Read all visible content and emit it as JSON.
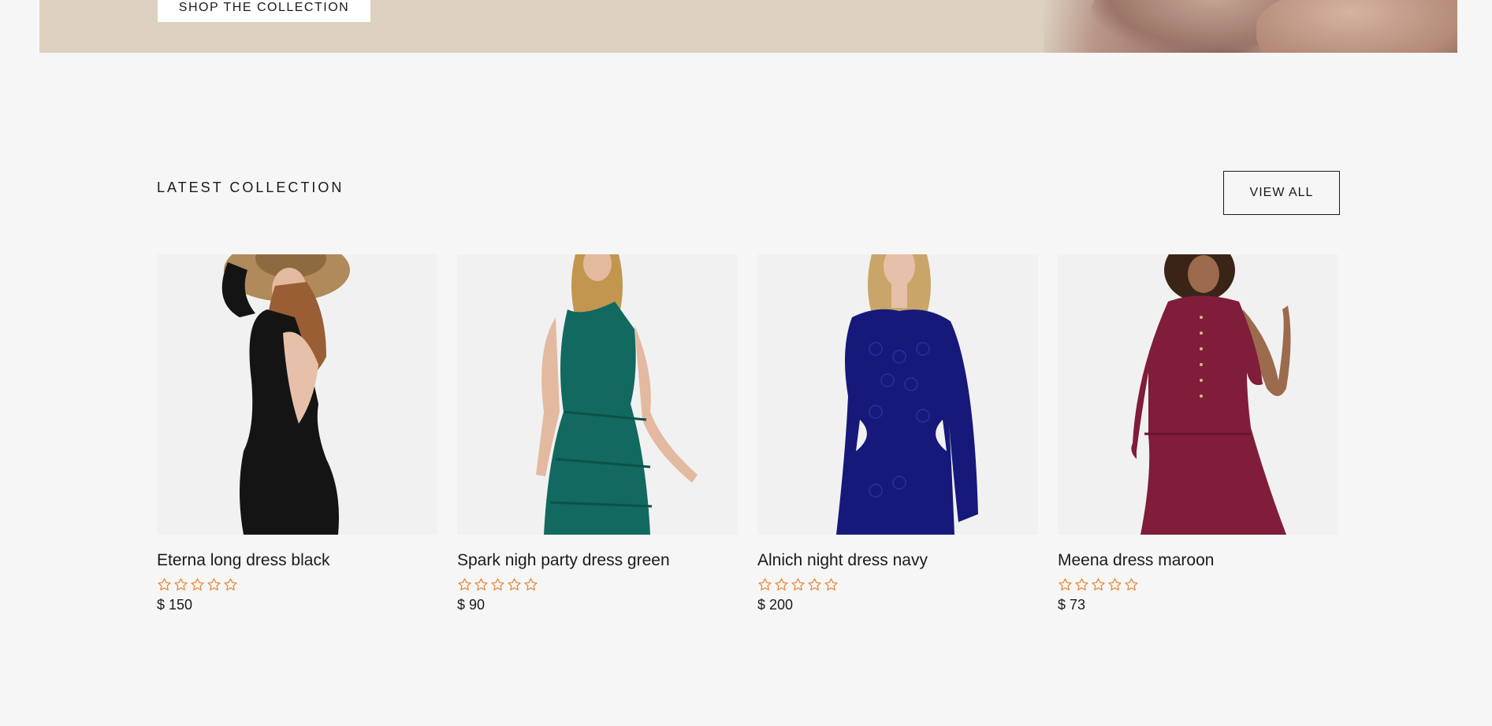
{
  "hero": {
    "button_label": "SHOP THE COLLECTION"
  },
  "section": {
    "title": "LATEST COLLECTION",
    "view_all_label": "VIEW ALL"
  },
  "products": [
    {
      "name": "Eterna long dress black",
      "rating": 0,
      "max_rating": 5,
      "price": "$ 150",
      "dress_color": "#141414"
    },
    {
      "name": "Spark nigh party dress green",
      "rating": 0,
      "max_rating": 5,
      "price": "$ 90",
      "dress_color": "#11695f"
    },
    {
      "name": "Alnich night dress navy",
      "rating": 0,
      "max_rating": 5,
      "price": "$ 200",
      "dress_color": "#16197a"
    },
    {
      "name": "Meena dress maroon",
      "rating": 0,
      "max_rating": 5,
      "price": "$ 73",
      "dress_color": "#7f1d3a"
    }
  ],
  "colors": {
    "background": "#f6f6f6",
    "hero_background": "#ddd1c1",
    "star_outline": "#e9883a",
    "text": "#1a1a1a"
  }
}
